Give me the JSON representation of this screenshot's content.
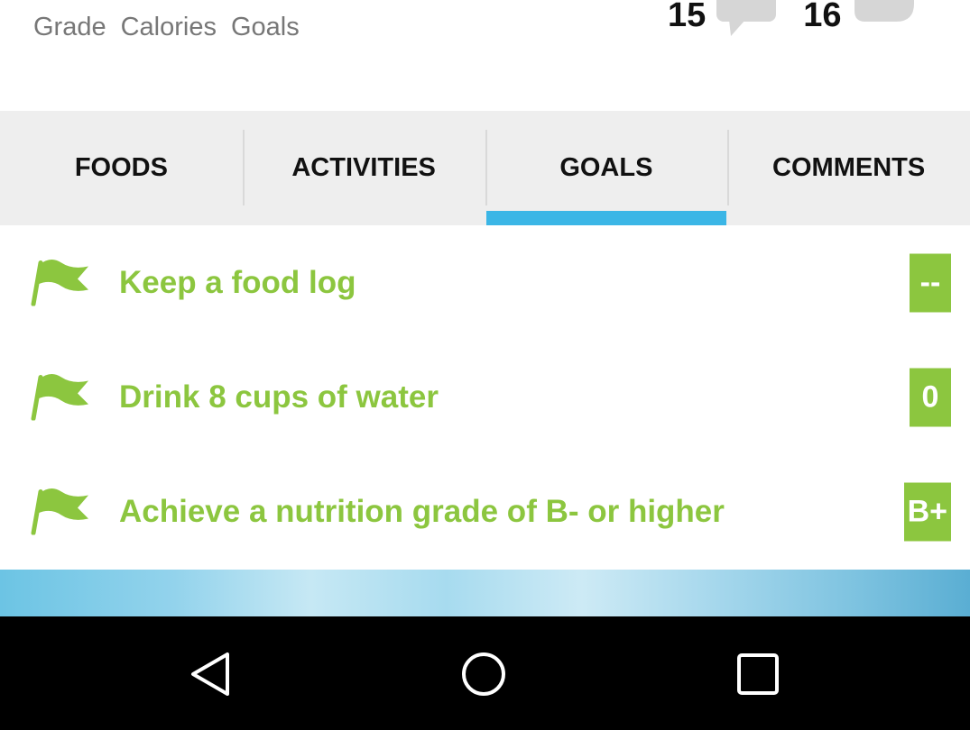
{
  "summary": {
    "stat_labels": [
      "Grade",
      "Calories",
      "Goals"
    ],
    "comments_count": "15",
    "likes_count": "16"
  },
  "tabs": [
    {
      "label": "FOODS",
      "active": false
    },
    {
      "label": "ACTIVITIES",
      "active": false
    },
    {
      "label": "GOALS",
      "active": true
    },
    {
      "label": "COMMENTS",
      "active": false
    }
  ],
  "goals": [
    {
      "label": "Keep a food log",
      "badge": "--"
    },
    {
      "label": "Drink 8 cups of water",
      "badge": "0"
    },
    {
      "label": "Achieve a nutrition grade of B- or higher",
      "badge": "B+"
    }
  ],
  "navbar": {
    "icons": [
      "back-icon",
      "home-icon",
      "recents-icon"
    ]
  },
  "colors": {
    "accent_green": "#8cc63f",
    "tab_indicator_blue": "#3bb6e6",
    "tab_background": "#eeeeee"
  }
}
